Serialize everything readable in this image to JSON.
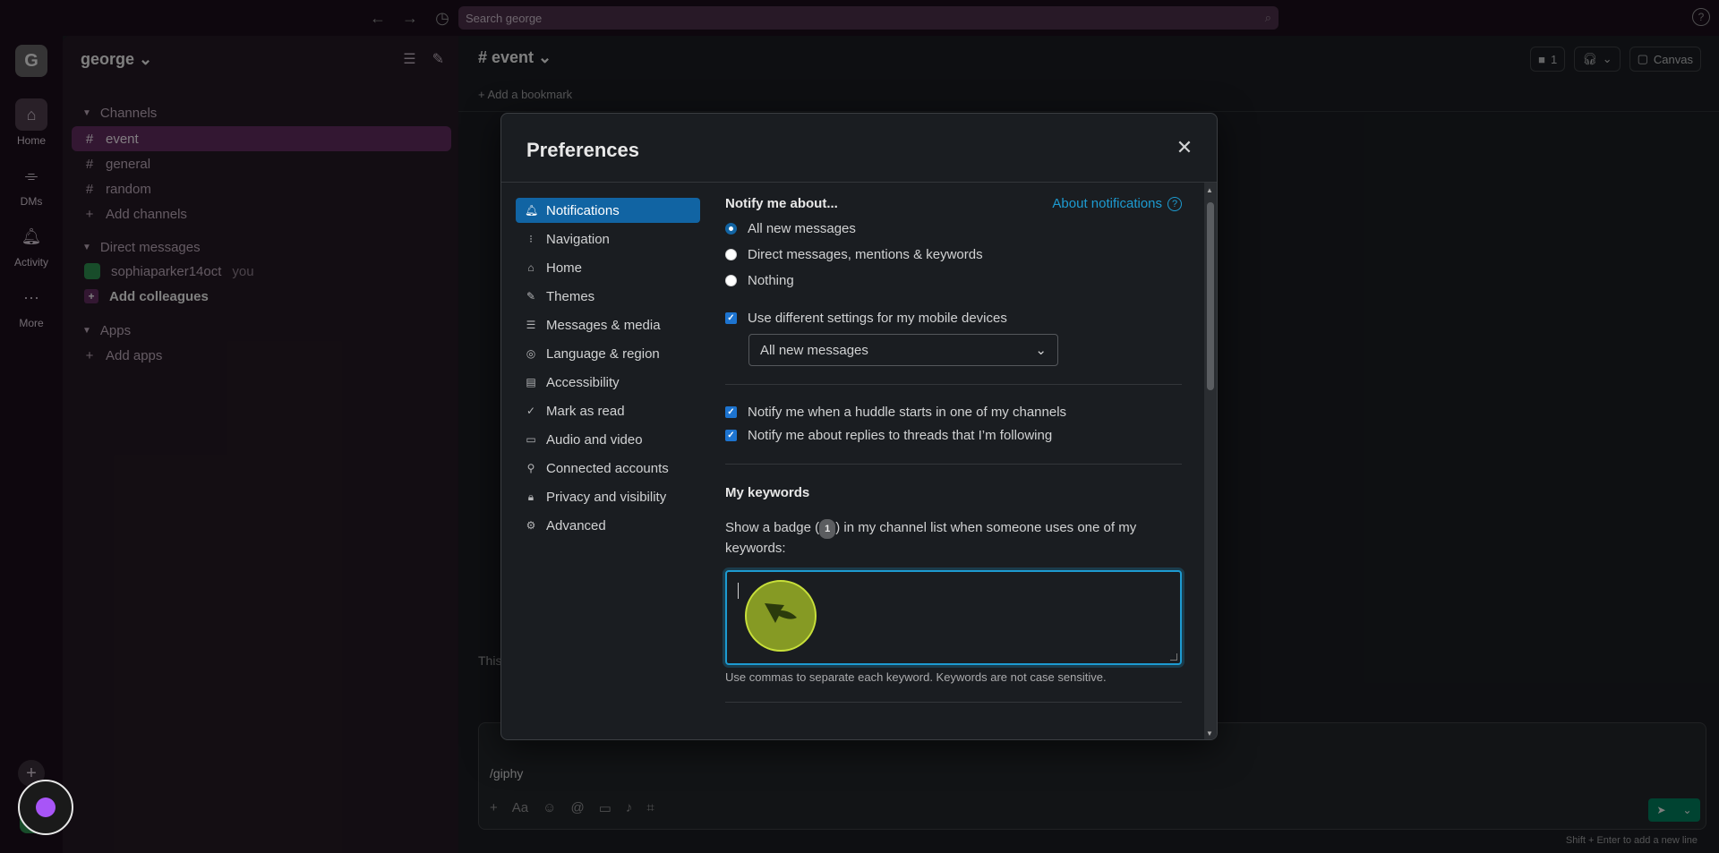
{
  "topbar": {
    "search_placeholder": "Search george",
    "help_label": "?"
  },
  "rail": {
    "workspace_initial": "G",
    "items": [
      {
        "label": "Home"
      },
      {
        "label": "DMs"
      },
      {
        "label": "Activity"
      },
      {
        "label": "More"
      }
    ]
  },
  "sidebar": {
    "workspace_name": "george ⌄",
    "channels_header": "Channels",
    "channels": [
      "event",
      "general",
      "random"
    ],
    "add_channels": "Add channels",
    "dm_header": "Direct messages",
    "dm_user": "sophiaparker14oct",
    "dm_you": "you",
    "add_colleagues": "Add colleagues",
    "apps_header": "Apps",
    "add_apps": "Add apps"
  },
  "main": {
    "channel_title": "# event ⌄",
    "bookmark": "+  Add a bookmark",
    "member_count": "1",
    "canvas_label": "Canvas",
    "partial_text": "This",
    "composer_text": "/giphy",
    "composer_hint": "Shift + Enter to add a new line"
  },
  "modal": {
    "title": "Preferences",
    "close": "✕",
    "menu": [
      {
        "label": "Notifications",
        "icon": "bell-icon"
      },
      {
        "label": "Navigation",
        "icon": "navigation-icon"
      },
      {
        "label": "Home",
        "icon": "home-icon"
      },
      {
        "label": "Themes",
        "icon": "brush-icon"
      },
      {
        "label": "Messages & media",
        "icon": "message-icon"
      },
      {
        "label": "Language & region",
        "icon": "globe-icon"
      },
      {
        "label": "Accessibility",
        "icon": "accessibility-icon"
      },
      {
        "label": "Mark as read",
        "icon": "check-circle-icon"
      },
      {
        "label": "Audio and video",
        "icon": "video-icon"
      },
      {
        "label": "Connected accounts",
        "icon": "plug-icon"
      },
      {
        "label": "Privacy and visibility",
        "icon": "lock-icon"
      },
      {
        "label": "Advanced",
        "icon": "gear-icon"
      }
    ],
    "notify_header": "Notify me about...",
    "about_link": "About notifications",
    "radio_options": [
      "All new messages",
      "Direct messages, mentions & keywords",
      "Nothing"
    ],
    "mobile_check": "Use different settings for my mobile devices",
    "mobile_select": "All new messages",
    "huddle_check": "Notify me when a huddle starts in one of my channels",
    "threads_check": "Notify me about replies to threads that I’m following",
    "keywords_header": "My keywords",
    "keywords_desc_pre": "Show a badge (",
    "keywords_badge": "1",
    "keywords_desc_post": ") in my channel list when someone uses one of my keywords:",
    "keywords_value": "",
    "keywords_help": "Use commas to separate each keyword. Keywords are not case sensitive."
  }
}
